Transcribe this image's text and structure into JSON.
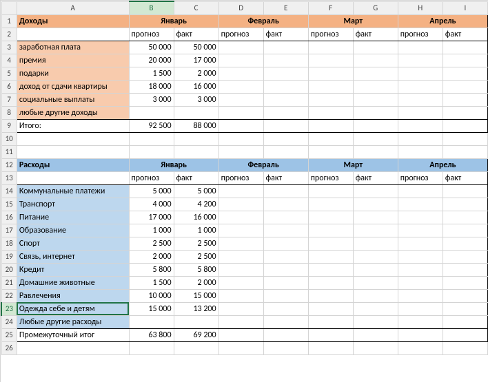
{
  "columns": [
    "A",
    "B",
    "C",
    "D",
    "E",
    "F",
    "G",
    "H",
    "I"
  ],
  "rows_count": 26,
  "active_col": "B",
  "active_row": 23,
  "months": [
    "Январь",
    "Февраль",
    "Март",
    "Апрель"
  ],
  "sub_headers": {
    "forecast": "прогноз",
    "fact": "факт"
  },
  "income": {
    "title": "Доходы",
    "items": [
      {
        "label": "заработная плата",
        "forecast": "50 000",
        "fact": "50 000"
      },
      {
        "label": "премия",
        "forecast": "20 000",
        "fact": "17 000"
      },
      {
        "label": "подарки",
        "forecast": "1 500",
        "fact": "2 000"
      },
      {
        "label": "доход от сдачи квартиры",
        "forecast": "18 000",
        "fact": "16 000"
      },
      {
        "label": "социальные выплаты",
        "forecast": "3 000",
        "fact": "3 000"
      },
      {
        "label": "любые другие доходы",
        "forecast": "",
        "fact": ""
      }
    ],
    "total_label": "Итого:",
    "total_forecast": "92 500",
    "total_fact": "88 000"
  },
  "expenses": {
    "title": "Расходы",
    "items": [
      {
        "label": "Коммунальные платежи",
        "forecast": "5 000",
        "fact": "5 000"
      },
      {
        "label": "Транспорт",
        "forecast": "4 000",
        "fact": "4 200"
      },
      {
        "label": "Питание",
        "forecast": "17 000",
        "fact": "16 000"
      },
      {
        "label": "Образование",
        "forecast": "1 000",
        "fact": "1 000"
      },
      {
        "label": "Спорт",
        "forecast": "2 500",
        "fact": "2 500"
      },
      {
        "label": "Связь, интернет",
        "forecast": "2 000",
        "fact": "2 500"
      },
      {
        "label": "Кредит",
        "forecast": "5 800",
        "fact": "5 800"
      },
      {
        "label": "Домашние животные",
        "forecast": "1 500",
        "fact": "2 000"
      },
      {
        "label": "Равлечения",
        "forecast": "10 000",
        "fact": "15 000"
      },
      {
        "label": "Одежда себе и детям",
        "forecast": "15 000",
        "fact": "13 200"
      },
      {
        "label": "Любые другие расходы",
        "forecast": "",
        "fact": ""
      }
    ],
    "subtotal_label": "Промежуточный итог",
    "subtotal_forecast": "63 800",
    "subtotal_fact": "69 200"
  }
}
